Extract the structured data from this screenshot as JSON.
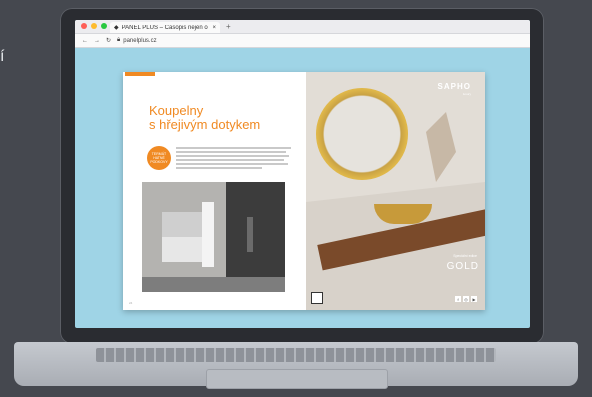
{
  "background_text": "í",
  "browser": {
    "tab_title": "PANEL PLUS – Ćasopis nejen o",
    "url": "panelplus.cz",
    "colors": {
      "red": "#fe5f57",
      "yellow": "#febc2e",
      "green": "#28c840"
    }
  },
  "left_page": {
    "title_line1": "Koupelny",
    "title_line2": "s hřejivým dotykem",
    "badge_text": "TERMÁT HATNÉ PODKOVY",
    "page_number": "24"
  },
  "right_page": {
    "brand": "SAPHO",
    "brand_sub": "luxury",
    "collection_label": "Speciální edice",
    "collection_name": "GOLD"
  }
}
